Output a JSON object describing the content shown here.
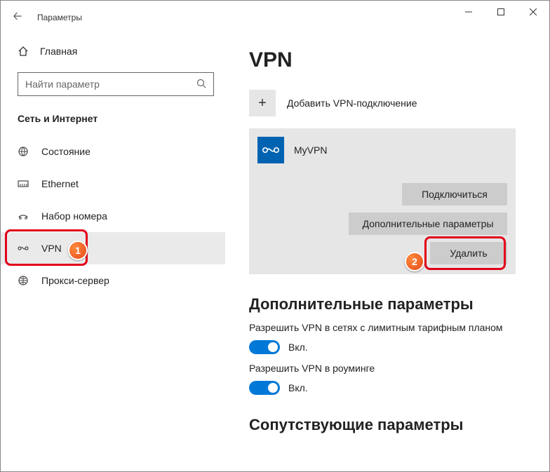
{
  "titlebar": {
    "text": "Параметры"
  },
  "sidebar": {
    "home": "Главная",
    "search_placeholder": "Найти параметр",
    "group": "Сеть и Интернет",
    "items": [
      {
        "label": "Состояние"
      },
      {
        "label": "Ethernet"
      },
      {
        "label": "Набор номера"
      },
      {
        "label": "VPN"
      },
      {
        "label": "Прокси-сервер"
      }
    ]
  },
  "content": {
    "title": "VPN",
    "add_label": "Добавить VPN-подключение",
    "connection": {
      "name": "MyVPN",
      "connect": "Подключиться",
      "advanced": "Дополнительные параметры",
      "delete": "Удалить"
    },
    "extra": {
      "heading": "Дополнительные параметры",
      "opt1_label": "Разрешить VPN в сетях с лимитным тарифным планом",
      "opt2_label": "Разрешить VPN в роуминге",
      "on": "Вкл."
    },
    "related_heading": "Сопутствующие параметры"
  },
  "annotations": {
    "badge1": "1",
    "badge2": "2"
  }
}
